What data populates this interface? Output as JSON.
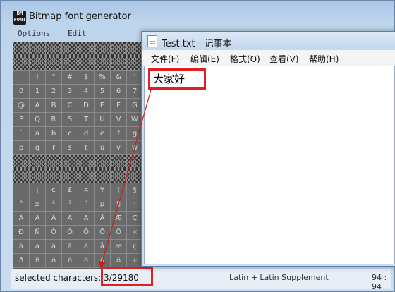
{
  "bmf": {
    "icon_text": "BM\nFONT",
    "title": "Bitmap font generator",
    "menu": [
      "Options",
      "Edit"
    ],
    "grid_rows": [
      [
        "#",
        "#",
        "#",
        "#",
        "#",
        "#",
        "#",
        "#"
      ],
      [
        "#",
        "#",
        "#",
        "#",
        "#",
        "#",
        "#",
        "#"
      ],
      [
        "",
        " !",
        "\"",
        "#",
        "$",
        "%",
        "&",
        "'"
      ],
      [
        "0",
        "1",
        "2",
        "3",
        "4",
        "5",
        "6",
        "7"
      ],
      [
        "@",
        "A",
        "B",
        "C",
        "D",
        "E",
        "F",
        "G"
      ],
      [
        "P",
        "Q",
        "R",
        "S",
        "T",
        "U",
        "V",
        "W"
      ],
      [
        "`",
        "a",
        "b",
        "c",
        "d",
        "e",
        "f",
        "g"
      ],
      [
        "p",
        "q",
        "r",
        "s",
        "t",
        "u",
        "v",
        "w"
      ],
      [
        "#",
        "#",
        "#",
        "#",
        "#",
        "#",
        "#",
        "#"
      ],
      [
        "#",
        "#",
        "#",
        "#",
        "#",
        "#",
        "#",
        "#"
      ],
      [
        "",
        "¡",
        "¢",
        "£",
        "¤",
        "¥",
        "¦",
        "§"
      ],
      [
        "°",
        "±",
        "²",
        "³",
        "´",
        "µ",
        "¶",
        "·"
      ],
      [
        "À",
        "Á",
        "Â",
        "Ã",
        "Ä",
        "Å",
        "Æ",
        "Ç"
      ],
      [
        "Ð",
        "Ñ",
        "Ò",
        "Ó",
        "Ô",
        "Õ",
        "Ö",
        "×"
      ],
      [
        "à",
        "á",
        "â",
        "ã",
        "ä",
        "å",
        "æ",
        "ç"
      ],
      [
        "ð",
        "ñ",
        "ò",
        "ó",
        "ô",
        "õ",
        "ö",
        "÷"
      ]
    ],
    "status": "selected characters: 3/29180",
    "bg_strip_left": "Latin + Latin Supplement",
    "bg_strip_right": "94 : 94"
  },
  "notepad": {
    "title": "Test.txt - 记事本",
    "menu": [
      "文件(F)",
      "编辑(E)",
      "格式(O)",
      "查看(V)",
      "帮助(H)"
    ],
    "content": "大家好"
  }
}
